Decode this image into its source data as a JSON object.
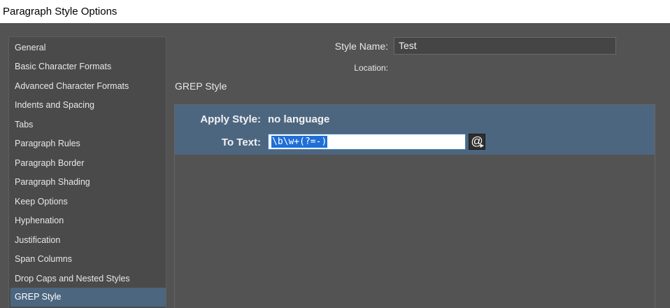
{
  "window": {
    "title": "Paragraph Style Options"
  },
  "sidebar": {
    "items": [
      {
        "label": "General"
      },
      {
        "label": "Basic Character Formats"
      },
      {
        "label": "Advanced Character Formats"
      },
      {
        "label": "Indents and Spacing"
      },
      {
        "label": "Tabs"
      },
      {
        "label": "Paragraph Rules"
      },
      {
        "label": "Paragraph Border"
      },
      {
        "label": "Paragraph Shading"
      },
      {
        "label": "Keep Options"
      },
      {
        "label": "Hyphenation"
      },
      {
        "label": "Justification"
      },
      {
        "label": "Span Columns"
      },
      {
        "label": "Drop Caps and Nested Styles"
      },
      {
        "label": "GREP Style"
      }
    ],
    "selected": "GREP Style"
  },
  "header": {
    "style_name_label": "Style Name:",
    "style_name_value": "Test",
    "location_label": "Location:"
  },
  "section": {
    "title": "GREP Style"
  },
  "grep_rule": {
    "apply_style_label": "Apply Style:",
    "apply_style_value": "no language",
    "to_text_label": "To Text:",
    "to_text_value": "\\b\\w+(?=-)",
    "special_chars_icon": "at-sign-icon"
  },
  "colors": {
    "background": "#535353",
    "selection": "#4d6680",
    "text_highlight": "#1f6fd6"
  }
}
